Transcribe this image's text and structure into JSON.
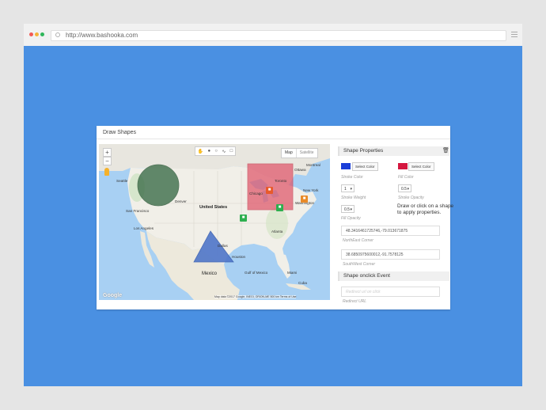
{
  "browser": {
    "url": "http://www.bashooka.com",
    "dot_colors": [
      "#f25a54",
      "#f5b337",
      "#2fb65a"
    ]
  },
  "card": {
    "title": "Draw Shapes"
  },
  "map": {
    "type_buttons": [
      "Map",
      "Satellite"
    ],
    "zoom_in": "+",
    "zoom_out": "−",
    "labels": {
      "united_states": "United States",
      "mexico": "Mexico",
      "cuba": "Cuba",
      "la": "Los Angeles",
      "sf": "San Francisco",
      "denver": "Denver",
      "dallas": "Dallas",
      "houston": "Houston",
      "chicago": "Chicago",
      "toronto": "Toronto",
      "new_york": "New York",
      "washington": "Washington",
      "atlanta": "Atlanta",
      "miami": "Miami",
      "seattle": "Seattle",
      "montreal": "Montreal",
      "ottawa": "Ottawa",
      "gulf": "Gulf of Mexico"
    },
    "google": "Google",
    "attribution": "Map data ©2017 Google, INEGI, ORION-ME   500 km   Terms of Use",
    "shape_colors": {
      "circle": "#3d6e4a",
      "rectangle": "#e0566a",
      "triangle": "#4f76c9"
    },
    "marker_colors": [
      "#2eaf4f",
      "#2eaf4f",
      "#e98a27",
      "#e85a2b"
    ]
  },
  "panel": {
    "properties_title": "Shape Properties",
    "stroke_color_button": "Select Color",
    "fill_color_button": "Select Color",
    "stroke_color_label": "Stroke Color",
    "fill_color_label": "Fill Color",
    "stroke_swatch": "#1b3fd8",
    "fill_swatch": "#d4173f",
    "stroke_weight_value": "1",
    "stroke_weight_label": "Stroke Weight",
    "fill_opacity_value": "0.5",
    "stroke_opacity_label": "Stroke Opacity",
    "stroke_opacity_value": "0.5",
    "fill_opacity_label": "Fill Opacity",
    "hint": "Draw or click on a shape to apply properties.",
    "ne_value": "48.3416461725746,-79.013671875",
    "ne_label": "NorthEast Corner",
    "sw_value": "38.6850975600012,-91.7578125",
    "sw_label": "SouthWest Corner",
    "onclick_title": "Shape onclick Event",
    "redirect_placeholder": "Redirect url on click",
    "redirect_label": "Redirect URL"
  }
}
